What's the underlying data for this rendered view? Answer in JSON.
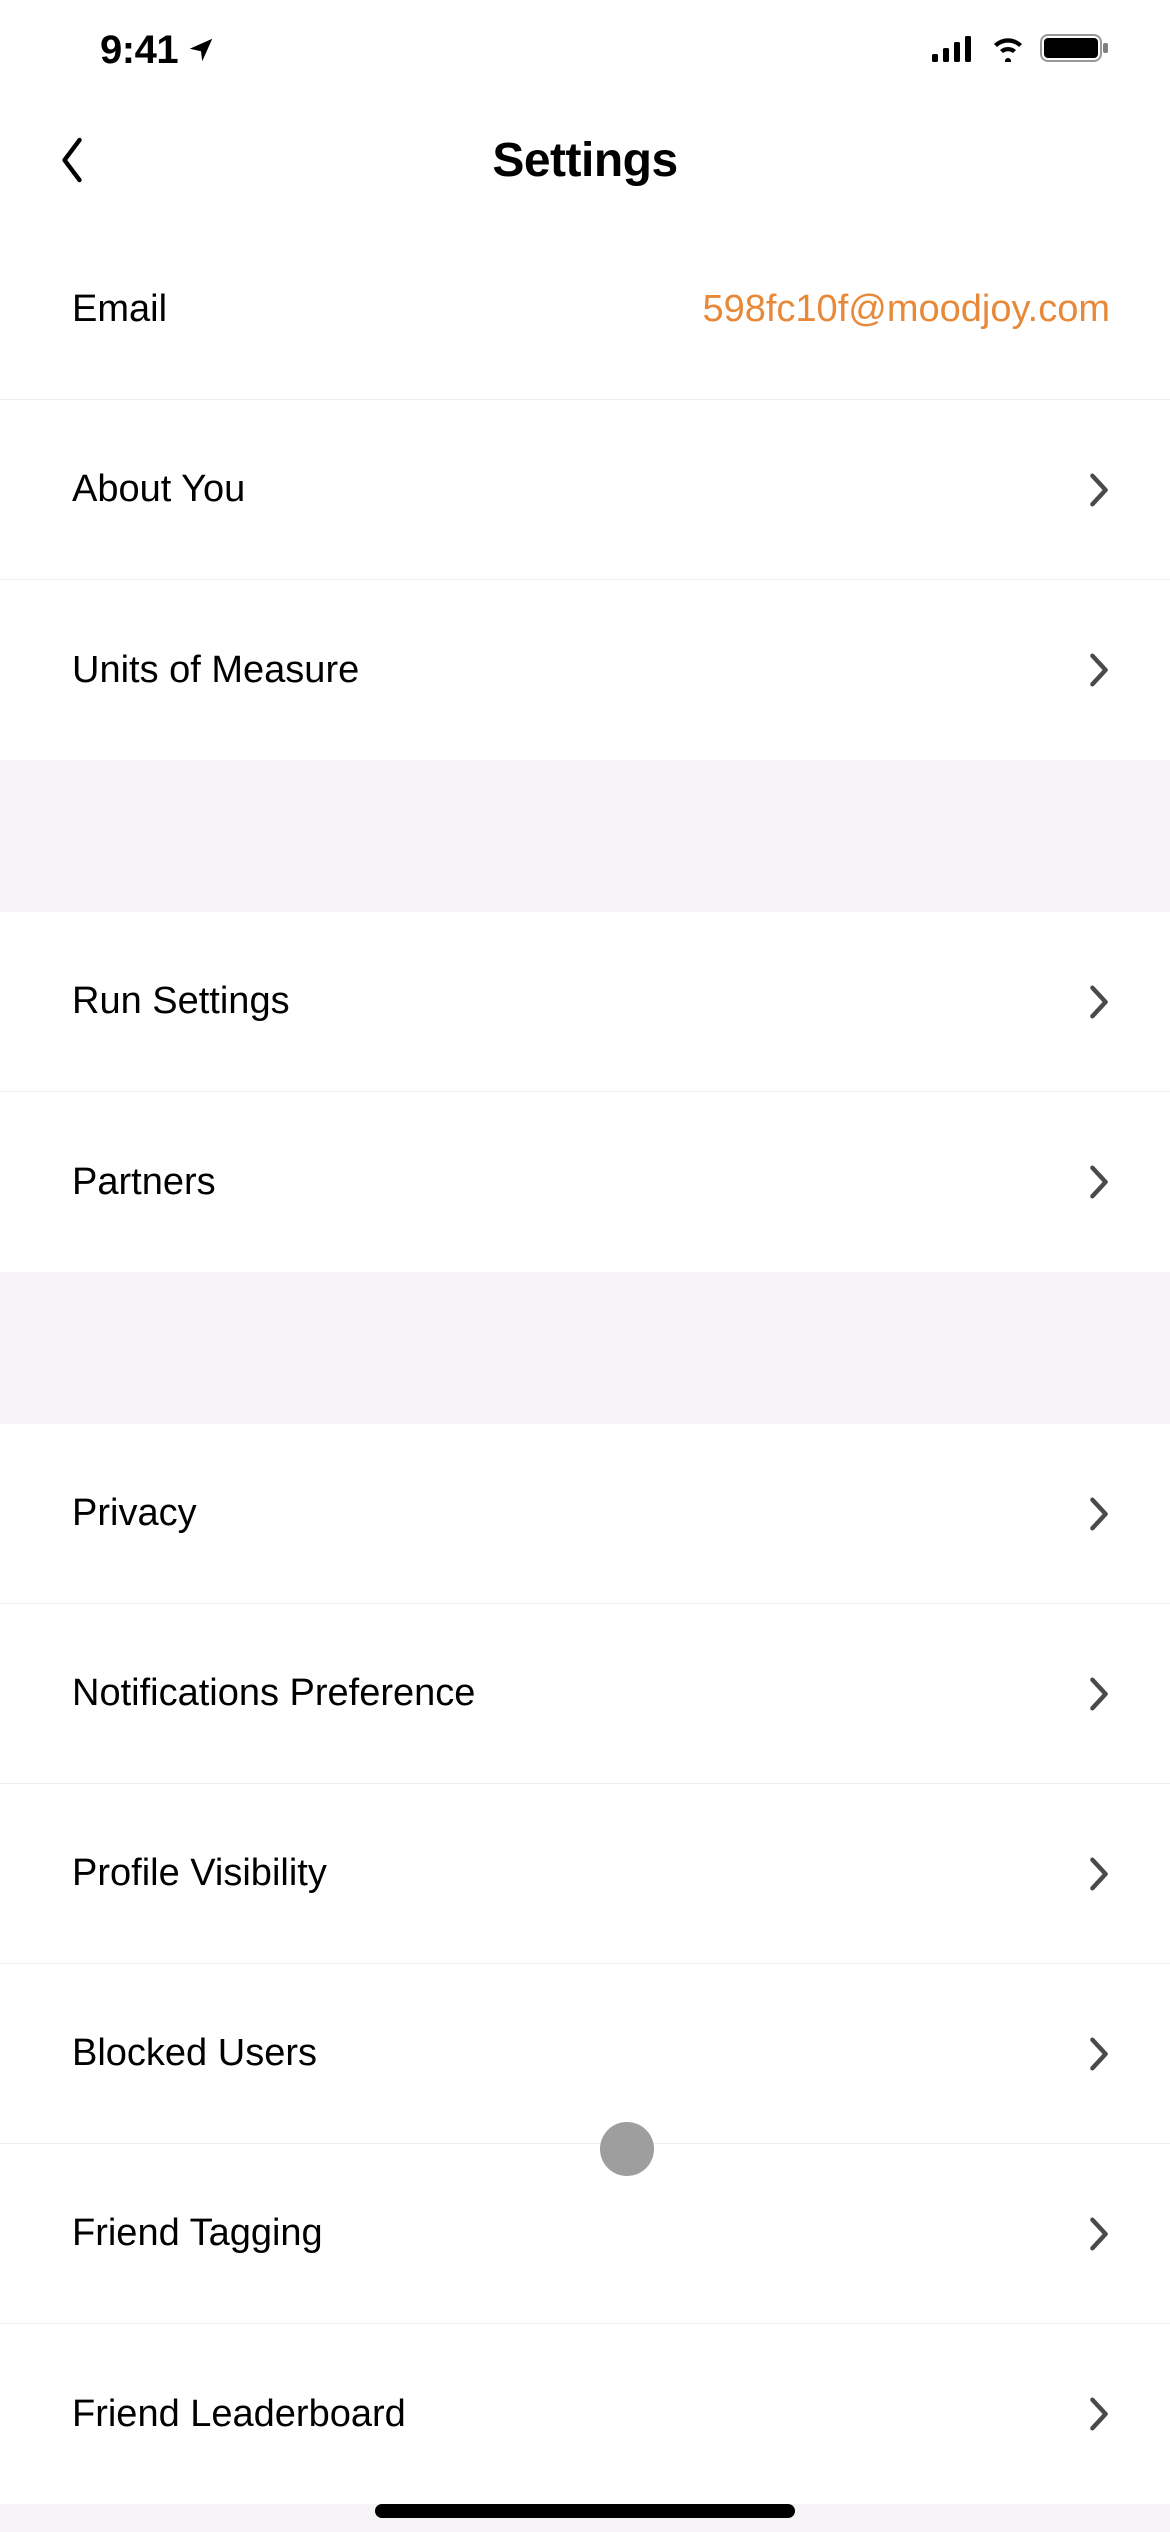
{
  "status": {
    "time": "9:41"
  },
  "header": {
    "title": "Settings"
  },
  "sections": [
    {
      "rows": [
        {
          "label": "Email",
          "value": "598fc10f@moodjoy.com",
          "hasChevron": false
        },
        {
          "label": "About You",
          "hasChevron": true
        },
        {
          "label": "Units of Measure",
          "hasChevron": true
        }
      ]
    },
    {
      "rows": [
        {
          "label": "Run Settings",
          "hasChevron": true
        },
        {
          "label": "Partners",
          "hasChevron": true
        }
      ]
    },
    {
      "rows": [
        {
          "label": "Privacy",
          "hasChevron": true
        },
        {
          "label": "Notifications Preference",
          "hasChevron": true
        },
        {
          "label": "Profile Visibility",
          "hasChevron": true
        },
        {
          "label": "Blocked Users",
          "hasChevron": true
        },
        {
          "label": "Friend Tagging",
          "hasChevron": true
        },
        {
          "label": "Friend Leaderboard",
          "hasChevron": true
        }
      ]
    }
  ]
}
